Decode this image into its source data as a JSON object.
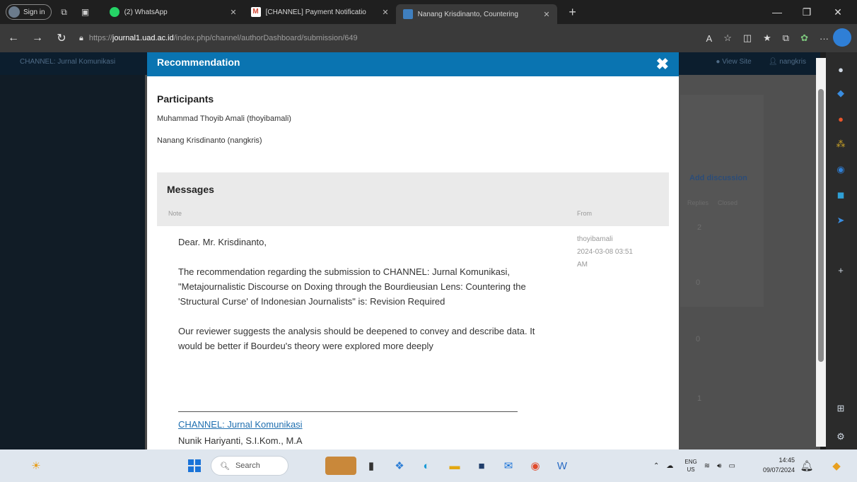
{
  "browser": {
    "signin_label": "Sign in",
    "tabs": [
      {
        "title": "(2) WhatsApp",
        "favicon_color": "#25d366"
      },
      {
        "title": "[CHANNEL] Payment Notificatio",
        "favicon_color": "#d14836"
      },
      {
        "title": "Nanang Krisdinanto, Countering",
        "favicon_color": "#3f7fbf",
        "active": true
      }
    ],
    "new_tab": "+",
    "url_prefix": "https://",
    "url_host": "journal1.uad.ac.id",
    "url_path": "/index.php/channel/authorDashboard/submission/649"
  },
  "page": {
    "site_title": "CHANNEL: Jurnal Komunikasi",
    "top_links": [
      "View Site",
      "nangkris"
    ],
    "bg_discussions_heading": "Add discussion",
    "bg_columns": [
      "Replies",
      "Closed"
    ],
    "bg_values": [
      "2",
      "0",
      "0",
      "1"
    ]
  },
  "modal": {
    "title": "Recommendation",
    "participants_heading": "Participants",
    "participants": [
      "Muhammad Thoyib Amali (thoyibamali)",
      "Nanang Krisdinanto (nangkris)"
    ],
    "messages_heading": "Messages",
    "col_note": "Note",
    "col_from": "From",
    "message": {
      "greeting": "Dear. Mr. Krisdinanto,",
      "para1": "The recommendation regarding the submission to CHANNEL: Jurnal Komunikasi, \"Metajournalistic Discourse on Doxing through the Bourdieusian Lens: Countering the 'Structural Curse' of Indonesian Journalists\" is: Revision Required",
      "para2": "Our reviewer suggests the analysis should be deepened to convey and describe data. It would be better if Bourdeu's theory were explored more deeply",
      "signature_link": "CHANNEL: Jurnal Komunikasi",
      "signature_name": "Nunik Hariyanti, S.I.Kom., M.A",
      "from_user": "thoyibamali",
      "from_date": "2024-03-08 03:51",
      "from_ampm": "AM"
    }
  },
  "taskbar": {
    "search_placeholder": "Search",
    "lang_top": "ENG",
    "lang_bottom": "US",
    "time": "14:45",
    "date": "09/07/2024"
  },
  "colors": {
    "modal_header": "#0a74b1",
    "link": "#1f6fb0"
  }
}
